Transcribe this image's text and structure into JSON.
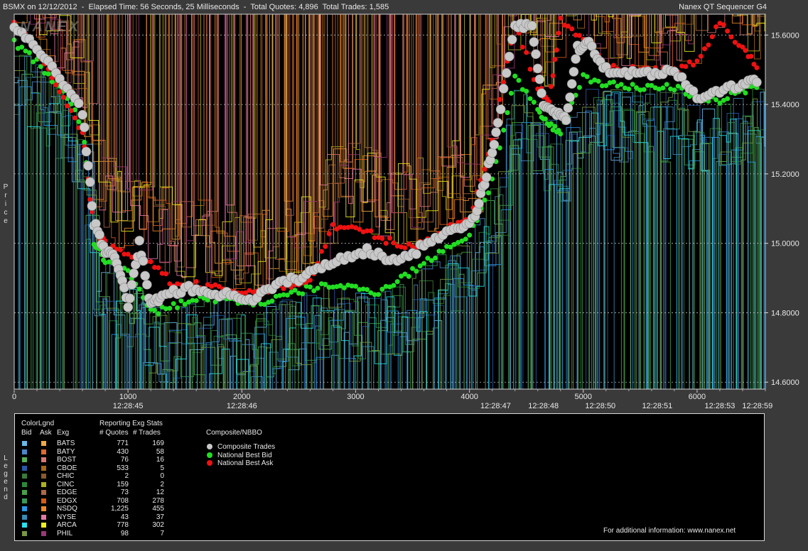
{
  "header": {
    "title": "BSMX on 12/12/2012  -  Elapsed Time: 56 Seconds, 25 Milliseconds  -  Total Quotes: 4,896  Total Trades: 1,585",
    "product": "Nanex QT Sequencer G4",
    "watermark": "NANEX"
  },
  "side_labels": {
    "price": "Price",
    "legend": "Legend"
  },
  "chart_data": {
    "type": "line",
    "title": "BSMX on 12/12/2012",
    "ylabel": "Price",
    "xlabel": "",
    "xlim": [
      0,
      6600
    ],
    "ylim": [
      14.58,
      15.66
    ],
    "y_ticks": [
      "15.6000",
      "15.4000",
      "15.2000",
      "15.0000",
      "14.8000",
      "14.6000"
    ],
    "y_tick_values": [
      15.6,
      15.4,
      15.2,
      15.0,
      14.8,
      14.6
    ],
    "x_ticks": [
      "0",
      "1000",
      "2000",
      "3000",
      "4000",
      "5000",
      "6000"
    ],
    "x_tick_values": [
      0,
      1000,
      2000,
      3000,
      4000,
      5000,
      6000
    ],
    "time_labels": [
      {
        "x": 1000,
        "label": "12:28:45"
      },
      {
        "x": 2000,
        "label": "12:28:46"
      },
      {
        "x": 4230,
        "label": "12:28:47"
      },
      {
        "x": 4650,
        "label": "12:28:48"
      },
      {
        "x": 5150,
        "label": "12:28:50"
      },
      {
        "x": 5650,
        "label": "12:28:51"
      },
      {
        "x": 6200,
        "label": "12:28:53"
      },
      {
        "x": 6530,
        "label": "12:28:59"
      }
    ],
    "series": [
      {
        "name": "Composite Trades",
        "color": "#c8c8c8",
        "x": [
          0,
          200,
          400,
          600,
          700,
          800,
          900,
          1000,
          1100,
          1200,
          1300,
          1500,
          1700,
          1900,
          2100,
          2300,
          2500,
          2700,
          2900,
          3100,
          3300,
          3500,
          3700,
          3900,
          4050,
          4150,
          4250,
          4400,
          4550,
          4650,
          4750,
          4850,
          4950,
          5050,
          5200,
          5400,
          5600,
          5800,
          6000,
          6200,
          6400,
          6550
        ],
        "values": [
          15.62,
          15.56,
          15.48,
          15.38,
          15.06,
          14.98,
          14.95,
          14.82,
          15.0,
          14.82,
          14.85,
          14.87,
          14.86,
          14.85,
          14.84,
          14.88,
          14.9,
          14.93,
          14.96,
          14.98,
          14.95,
          14.97,
          15.02,
          15.04,
          15.07,
          15.2,
          15.34,
          15.63,
          15.62,
          15.4,
          15.38,
          15.36,
          15.56,
          15.58,
          15.5,
          15.49,
          15.49,
          15.5,
          15.42,
          15.44,
          15.46,
          15.47
        ]
      },
      {
        "name": "National Best Bid",
        "color": "#22dd22",
        "x": [
          0,
          200,
          400,
          600,
          700,
          800,
          1000,
          1200,
          1400,
          1600,
          1800,
          2000,
          2200,
          2400,
          2600,
          2800,
          3000,
          3200,
          3400,
          3600,
          3800,
          4000,
          4200,
          4400,
          4600,
          4700,
          4800,
          5000,
          5200,
          5400,
          5600,
          5800,
          6000,
          6200,
          6400,
          6550
        ],
        "values": [
          15.58,
          15.52,
          15.45,
          15.34,
          15.0,
          14.95,
          14.92,
          14.8,
          14.82,
          14.84,
          14.84,
          14.83,
          14.83,
          14.85,
          14.87,
          14.88,
          14.87,
          14.86,
          14.9,
          14.94,
          14.99,
          15.02,
          15.18,
          15.48,
          15.38,
          15.34,
          15.32,
          15.48,
          15.46,
          15.45,
          15.45,
          15.45,
          15.42,
          15.41,
          15.44,
          15.45
        ]
      },
      {
        "name": "National Best Ask",
        "color": "#ee1111",
        "x": [
          0,
          200,
          400,
          600,
          700,
          800,
          1000,
          1200,
          1400,
          1600,
          1800,
          2000,
          2200,
          2400,
          2600,
          2800,
          3000,
          3200,
          3400,
          3600,
          3800,
          4000,
          4200,
          4400,
          4600,
          4700,
          4800,
          5000,
          5200,
          5400,
          5600,
          5800,
          6000,
          6200,
          6400,
          6550
        ],
        "values": [
          15.63,
          15.56,
          15.44,
          15.32,
          15.04,
          15.0,
          14.96,
          14.95,
          14.88,
          14.88,
          14.87,
          14.86,
          14.86,
          14.88,
          14.89,
          15.05,
          15.04,
          15.02,
          14.99,
          15.0,
          15.04,
          15.07,
          15.3,
          15.63,
          15.45,
          15.41,
          15.64,
          15.59,
          15.51,
          15.5,
          15.5,
          15.5,
          15.52,
          15.64,
          15.56,
          15.5
        ]
      }
    ]
  },
  "legend": {
    "colorlgnd_title": "ColorLgnd",
    "bid_header": "Bid",
    "ask_header": "Ask",
    "exg_header": "Exg",
    "stats_title": "Reporting Exg Stats",
    "quotes_header": "# Quotes",
    "trades_header": "# Trades",
    "composite_title": "Composite/NBBO",
    "exchanges": [
      {
        "exg": "BATS",
        "quotes": "771",
        "trades": "169",
        "bid_color": "#6ab8e8",
        "ask_color": "#f0a848"
      },
      {
        "exg": "BATY",
        "quotes": "430",
        "trades": "58",
        "bid_color": "#4a88c8",
        "ask_color": "#e06a30"
      },
      {
        "exg": "BOST",
        "quotes": "76",
        "trades": "16",
        "bid_color": "#58b058",
        "ask_color": "#d87878"
      },
      {
        "exg": "CBOE",
        "quotes": "533",
        "trades": "5",
        "bid_color": "#2a58a8",
        "ask_color": "#a86818"
      },
      {
        "exg": "CHIC",
        "quotes": "2",
        "trades": "0",
        "bid_color": "#3a7a3a",
        "ask_color": "#8a5a2a"
      },
      {
        "exg": "CINC",
        "quotes": "159",
        "trades": "2",
        "bid_color": "#2a8a3a",
        "ask_color": "#b0b020"
      },
      {
        "exg": "EDGE",
        "quotes": "73",
        "trades": "12",
        "bid_color": "#48a048",
        "ask_color": "#b06848"
      },
      {
        "exg": "EDGX",
        "quotes": "708",
        "trades": "278",
        "bid_color": "#3a9858",
        "ask_color": "#d85a18"
      },
      {
        "exg": "NSDQ",
        "quotes": "1,225",
        "trades": "455",
        "bid_color": "#2a98e8",
        "ask_color": "#f08828"
      },
      {
        "exg": "NYSE",
        "quotes": "43",
        "trades": "37",
        "bid_color": "#3a8ab8",
        "ask_color": "#e878a8"
      },
      {
        "exg": "ARCA",
        "quotes": "778",
        "trades": "302",
        "bid_color": "#28e0f0",
        "ask_color": "#f0f020"
      },
      {
        "exg": "PHIL",
        "quotes": "98",
        "trades": "7",
        "bid_color": "#789840",
        "ask_color": "#983878"
      }
    ],
    "nbbo": [
      {
        "label": "Composite Trades",
        "color": "#c8c8c8"
      },
      {
        "label": "National Best Bid",
        "color": "#22dd22"
      },
      {
        "label": "National Best Ask",
        "color": "#ee1111"
      }
    ],
    "footer": "For additional information: www.nanex.net"
  }
}
